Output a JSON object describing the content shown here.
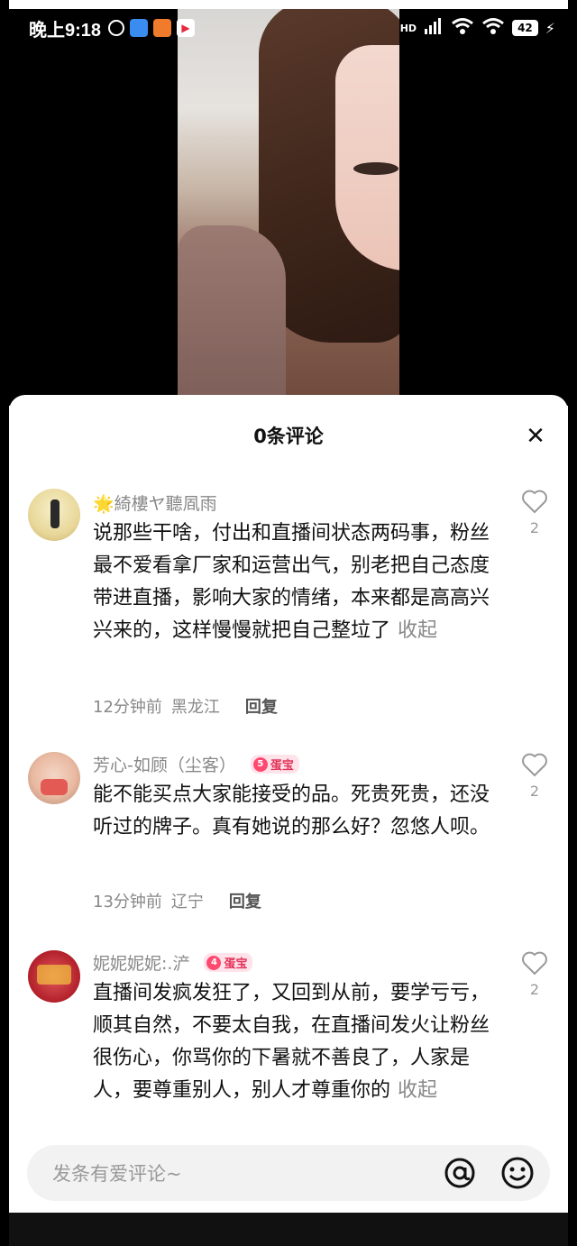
{
  "status_bar": {
    "time": "晚上9:18",
    "network": "HD",
    "battery": "42"
  },
  "sheet": {
    "title": "0条评论",
    "close_icon": "close-icon"
  },
  "comments": [
    {
      "username": "🌟綺樓ヤ聽凮雨",
      "text": "说那些干啥，付出和直播间状态两码事，粉丝最不爱看拿厂家和运营出气，别老把自己态度带进直播，影响大家的情绪，本来都是高高兴兴来的，这样慢慢就把自己整垃了",
      "fold": "收起",
      "time": "12分钟前",
      "location": "黑龙江",
      "reply": "回复",
      "likes": "2"
    },
    {
      "username": "芳心-如顾（尘客）",
      "badge_level": "5",
      "badge_text": "蛋宝",
      "text": "能不能买点大家能接受的品。死贵死贵，还没听过的牌子。真有她说的那么好？忽悠人呗。",
      "time": "13分钟前",
      "location": "辽宁",
      "reply": "回复",
      "likes": "2"
    },
    {
      "username": "妮妮妮妮:.浐",
      "badge_level": "4",
      "badge_text": "蛋宝",
      "text": "直播间发疯发狂了，又回到从前，要学亏亏，顺其自然，不要太自我，在直播间发火让粉丝很伤心，你骂你的下暑就不善良了，人家是人，要尊重别人，别人才尊重你的",
      "fold": "收起",
      "likes": "2"
    }
  ],
  "input": {
    "placeholder": "发条有爱评论~"
  }
}
